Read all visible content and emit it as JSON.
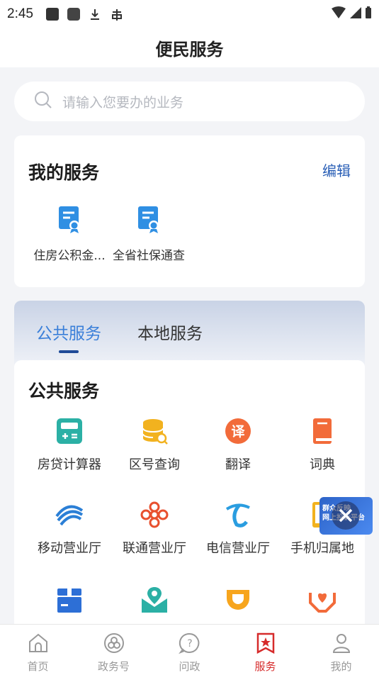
{
  "status_bar": {
    "time": "2:45"
  },
  "header": {
    "title": "便民服务"
  },
  "search": {
    "placeholder": "请输入您要办的业务"
  },
  "my_services": {
    "title": "我的服务",
    "edit_label": "编辑",
    "items": [
      {
        "label": "住房公积金...",
        "icon": "certificate-icon"
      },
      {
        "label": "全省社保通查",
        "icon": "certificate-icon"
      }
    ]
  },
  "tabs": [
    {
      "label": "公共服务",
      "active": true
    },
    {
      "label": "本地服务",
      "active": false
    }
  ],
  "public_services": {
    "title": "公共服务",
    "items": [
      {
        "label": "房贷计算器",
        "icon": "calculator-icon",
        "color": "#2bb0a5"
      },
      {
        "label": "区号查询",
        "icon": "database-search-icon",
        "color": "#f2b21f"
      },
      {
        "label": "翻译",
        "icon": "translate-icon",
        "color": "#f26b3a"
      },
      {
        "label": "词典",
        "icon": "dictionary-icon",
        "color": "#f26b3a"
      },
      {
        "label": "移动营业厅",
        "icon": "china-mobile-icon",
        "color": "#2b7fd6"
      },
      {
        "label": "联通营业厅",
        "icon": "china-unicom-icon",
        "color": "#e8502e"
      },
      {
        "label": "电信营业厅",
        "icon": "china-telecom-icon",
        "color": "#2a9de0"
      },
      {
        "label": "手机归属地",
        "icon": "phone-location-icon",
        "color": "#f2b21f"
      },
      {
        "label": "",
        "icon": "package-icon",
        "color": "#2d6fd6"
      },
      {
        "label": "",
        "icon": "envelope-location-icon",
        "color": "#2bb0a5"
      },
      {
        "label": "",
        "icon": "didi-icon",
        "color": "#f7a51d"
      },
      {
        "label": "",
        "icon": "care-hands-icon",
        "color": "#f26b3a"
      }
    ]
  },
  "floating_badge": {
    "text_line1": "群众反映",
    "text_line2": "网上投诉平台"
  },
  "bottom_nav": [
    {
      "label": "首页",
      "icon": "home-icon",
      "active": false
    },
    {
      "label": "政务号",
      "icon": "government-icon",
      "active": false
    },
    {
      "label": "问政",
      "icon": "question-icon",
      "active": false
    },
    {
      "label": "服务",
      "icon": "service-star-icon",
      "active": true
    },
    {
      "label": "我的",
      "icon": "profile-icon",
      "active": false
    }
  ],
  "colors": {
    "accent_blue": "#3a7fd9",
    "active_red": "#d62b2b",
    "edit_blue": "#2a5fb6"
  }
}
